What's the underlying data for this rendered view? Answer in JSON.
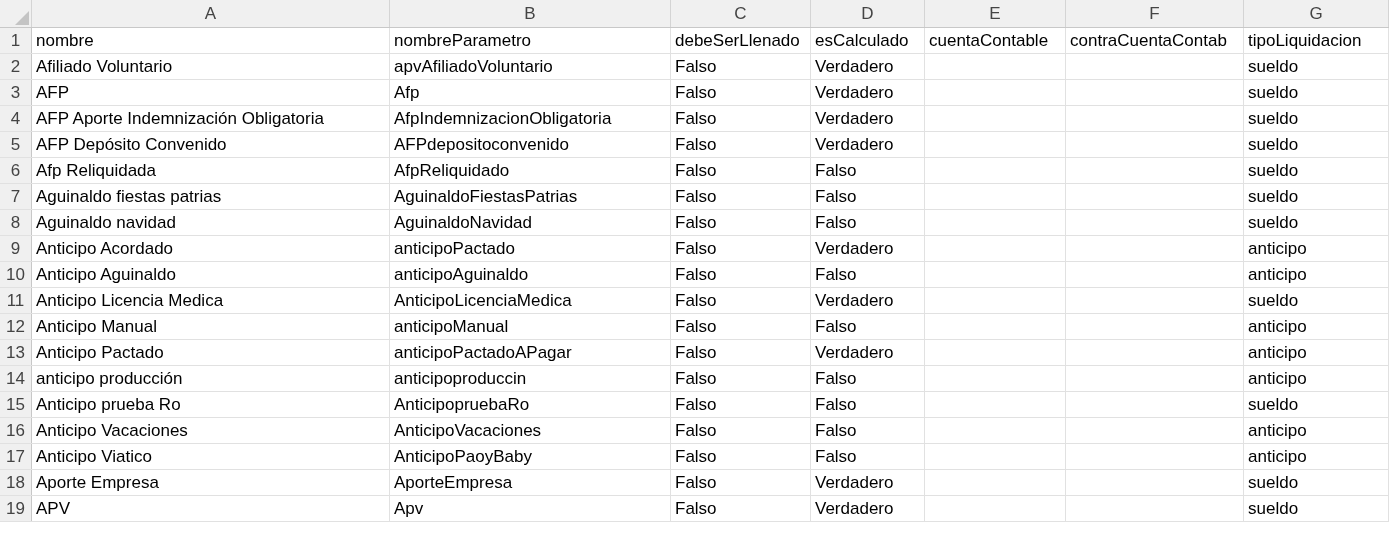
{
  "columns": [
    "A",
    "B",
    "C",
    "D",
    "E",
    "F",
    "G"
  ],
  "rows": [
    {
      "number": "1",
      "cells": [
        "nombre",
        "nombreParametro",
        "debeSerLlenado",
        "esCalculado",
        "cuentaContable",
        "contraCuentaContab",
        "tipoLiquidacion"
      ]
    },
    {
      "number": "2",
      "cells": [
        "Afiliado Voluntario",
        "apvAfiliadoVoluntario",
        "Falso",
        "Verdadero",
        null,
        null,
        "sueldo"
      ]
    },
    {
      "number": "3",
      "cells": [
        "AFP",
        "Afp",
        "Falso",
        "Verdadero",
        null,
        null,
        "sueldo"
      ]
    },
    {
      "number": "4",
      "cells": [
        "AFP Aporte Indemnización Obligatoria",
        "AfpIndemnizacionObligatoria",
        "Falso",
        "Verdadero",
        null,
        null,
        "sueldo"
      ]
    },
    {
      "number": "5",
      "cells": [
        "AFP Depósito Convenido",
        "AFPdepositoconvenido",
        "Falso",
        "Verdadero",
        null,
        null,
        "sueldo"
      ]
    },
    {
      "number": "6",
      "cells": [
        "Afp Reliquidada",
        "AfpReliquidado",
        "Falso",
        "Falso",
        null,
        null,
        "sueldo"
      ]
    },
    {
      "number": "7",
      "cells": [
        "Aguinaldo fiestas patrias",
        "AguinaldoFiestasPatrias",
        "Falso",
        "Falso",
        null,
        null,
        "sueldo"
      ]
    },
    {
      "number": "8",
      "cells": [
        "Aguinaldo navidad",
        "AguinaldoNavidad",
        "Falso",
        "Falso",
        null,
        null,
        "sueldo"
      ]
    },
    {
      "number": "9",
      "cells": [
        "Anticipo Acordado",
        "anticipoPactado",
        "Falso",
        "Verdadero",
        null,
        null,
        "anticipo"
      ]
    },
    {
      "number": "10",
      "cells": [
        "Anticipo Aguinaldo",
        "anticipoAguinaldo",
        "Falso",
        "Falso",
        null,
        null,
        "anticipo"
      ]
    },
    {
      "number": "11",
      "cells": [
        "Anticipo Licencia Medica",
        "AnticipoLicenciaMedica",
        "Falso",
        "Verdadero",
        null,
        null,
        "sueldo"
      ]
    },
    {
      "number": "12",
      "cells": [
        "Anticipo Manual",
        "anticipoManual",
        "Falso",
        "Falso",
        null,
        null,
        "anticipo"
      ]
    },
    {
      "number": "13",
      "cells": [
        "Anticipo Pactado",
        "anticipoPactadoAPagar",
        "Falso",
        "Verdadero",
        null,
        null,
        "anticipo"
      ]
    },
    {
      "number": "14",
      "cells": [
        "anticipo producción",
        "anticipoproduccin",
        "Falso",
        "Falso",
        null,
        null,
        "anticipo"
      ]
    },
    {
      "number": "15",
      "cells": [
        "Anticipo prueba Ro",
        "AnticipopruebaRo",
        "Falso",
        "Falso",
        null,
        null,
        "sueldo"
      ]
    },
    {
      "number": "16",
      "cells": [
        "Anticipo Vacaciones",
        "AnticipoVacaciones",
        "Falso",
        "Falso",
        null,
        null,
        "anticipo"
      ]
    },
    {
      "number": "17",
      "cells": [
        "Anticipo Viatico",
        "AnticipoPaoyBaby",
        "Falso",
        "Falso",
        null,
        null,
        "anticipo"
      ]
    },
    {
      "number": "18",
      "cells": [
        "Aporte Empresa",
        "AporteEmpresa",
        "Falso",
        "Verdadero",
        null,
        null,
        "sueldo"
      ]
    },
    {
      "number": "19",
      "cells": [
        "APV",
        "Apv",
        "Falso",
        "Verdadero",
        null,
        null,
        "sueldo"
      ]
    }
  ]
}
